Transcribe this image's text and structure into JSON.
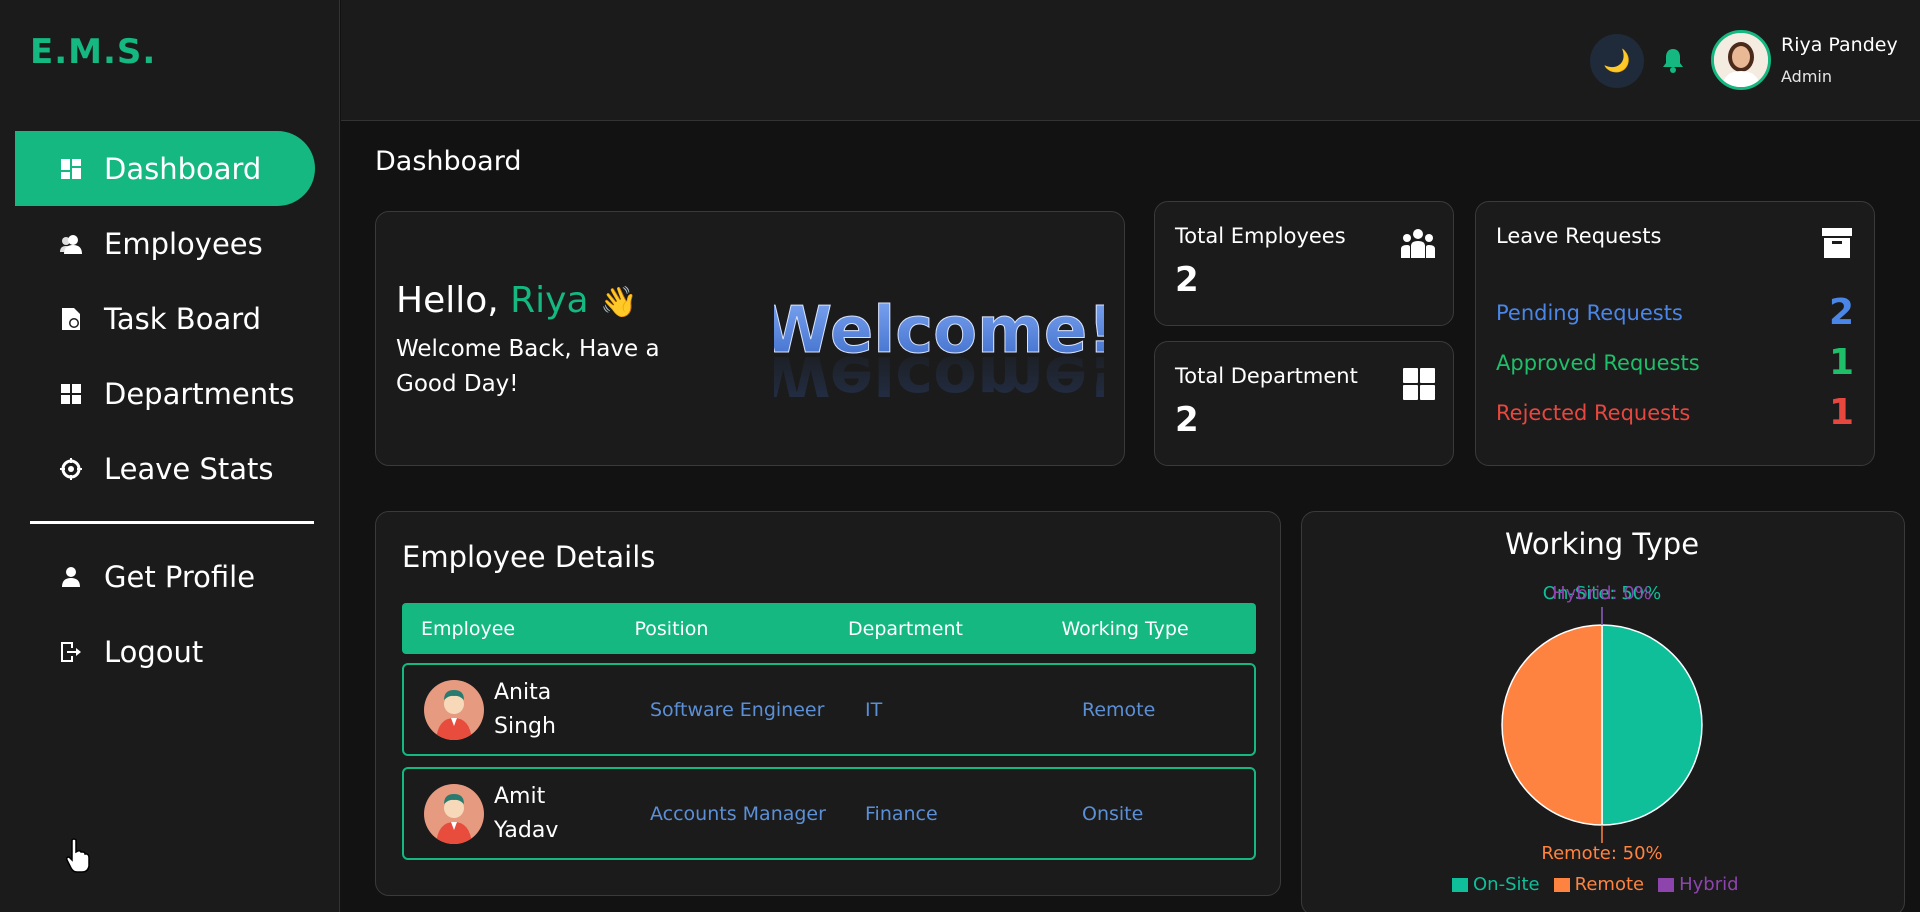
{
  "app": {
    "logo": "E.M.S."
  },
  "sidebar": {
    "items": [
      {
        "label": "Dashboard",
        "icon": "dashboard-icon",
        "active": true
      },
      {
        "label": "Employees",
        "icon": "users-icon",
        "active": false
      },
      {
        "label": "Task Board",
        "icon": "task-icon",
        "active": false
      },
      {
        "label": "Departments",
        "icon": "grid-icon",
        "active": false
      },
      {
        "label": "Leave Stats",
        "icon": "crosshair-icon",
        "active": false
      }
    ],
    "bottom_items": [
      {
        "label": "Get Profile",
        "icon": "user-icon"
      },
      {
        "label": "Logout",
        "icon": "logout-icon"
      }
    ]
  },
  "topbar": {
    "user_name": "Riya Pandey",
    "user_role": "Admin",
    "theme_icon": "moon-icon",
    "notification_icon": "bell-icon"
  },
  "page": {
    "title": "Dashboard"
  },
  "welcome": {
    "greeting": "Hello, ",
    "name": "Riya",
    "wave": "👋",
    "subtitle": "Welcome Back, Have a Good Day!",
    "art_text": "Welcome!"
  },
  "stats": {
    "employees": {
      "label": "Total Employees",
      "value": "2",
      "icon": "people-icon"
    },
    "departments": {
      "label": "Total Department",
      "value": "2",
      "icon": "grid-icon"
    }
  },
  "leave": {
    "title": "Leave Requests",
    "icon": "archive-icon",
    "rows": [
      {
        "label": "Pending Requests",
        "value": "2",
        "color": "#4a86e8"
      },
      {
        "label": "Approved Requests",
        "value": "1",
        "color": "#1fbf6a"
      },
      {
        "label": "Rejected Requests",
        "value": "1",
        "color": "#e8473f"
      }
    ]
  },
  "employees": {
    "title": "Employee Details",
    "columns": [
      "Employee",
      "Position",
      "Department",
      "Working Type"
    ],
    "rows": [
      {
        "name": "Anita Singh",
        "position": "Software Engineer",
        "department": "IT",
        "working_type": "Remote"
      },
      {
        "name": "Amit Yadav",
        "position": "Accounts Manager",
        "department": "Finance",
        "working_type": "Onsite"
      }
    ]
  },
  "chart_data": {
    "type": "pie",
    "title": "Working Type",
    "slices": [
      {
        "name": "On-Site",
        "value": 50,
        "label": "On-Site: 50%",
        "color": "#0fbf9a"
      },
      {
        "name": "Remote",
        "value": 50,
        "label": "Remote: 50%",
        "color": "#ff8340"
      },
      {
        "name": "Hybrid",
        "value": 0,
        "label": "Hybrid: 0%",
        "color": "#8e44ad"
      }
    ],
    "legend": [
      "On-Site",
      "Remote",
      "Hybrid"
    ],
    "legend_position": "bottom"
  }
}
